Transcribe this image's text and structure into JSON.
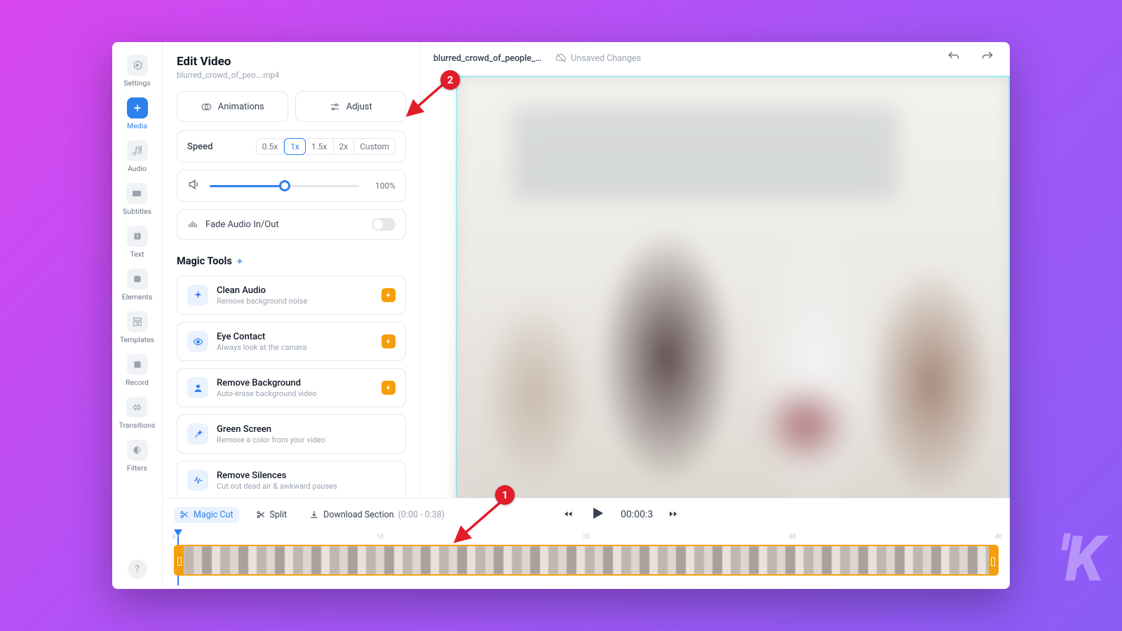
{
  "nav": {
    "items": [
      {
        "label": "Settings",
        "icon": "gear"
      },
      {
        "label": "Media",
        "icon": "plus",
        "active": true
      },
      {
        "label": "Audio",
        "icon": "music"
      },
      {
        "label": "Subtitles",
        "icon": "cc"
      },
      {
        "label": "Text",
        "icon": "text"
      },
      {
        "label": "Elements",
        "icon": "shapes"
      },
      {
        "label": "Templates",
        "icon": "templates"
      },
      {
        "label": "Record",
        "icon": "record"
      },
      {
        "label": "Transitions",
        "icon": "transitions"
      },
      {
        "label": "Filters",
        "icon": "filters"
      }
    ]
  },
  "panel": {
    "title": "Edit Video",
    "subtitle": "blurred_crowd_of_peo….mp4",
    "tabs": {
      "animations": "Animations",
      "adjust": "Adjust"
    },
    "speed": {
      "label": "Speed",
      "options": [
        "0.5x",
        "1x",
        "1.5x",
        "2x",
        "Custom"
      ],
      "selected": "1x"
    },
    "volume": {
      "percent": "100%",
      "value": 50
    },
    "fade": {
      "label": "Fade Audio In/Out",
      "on": false
    },
    "magic_heading": "Magic Tools",
    "tools": [
      {
        "title": "Clean Audio",
        "desc": "Remove background noise",
        "icon": "sparkle",
        "bolt": true
      },
      {
        "title": "Eye Contact",
        "desc": "Always look at the camera",
        "icon": "eye",
        "bolt": true
      },
      {
        "title": "Remove Background",
        "desc": "Auto-erase background video",
        "icon": "person",
        "bolt": true
      },
      {
        "title": "Green Screen",
        "desc": "Remove a color from your video",
        "icon": "wand",
        "bolt": false
      },
      {
        "title": "Remove Silences",
        "desc": "Cut out dead air & awkward pauses",
        "icon": "wave",
        "bolt": false
      }
    ]
  },
  "header": {
    "doc_name": "blurred_crowd_of_people_…",
    "unsaved": "Unsaved Changes"
  },
  "timeline": {
    "magic_cut": "Magic Cut",
    "split": "Split",
    "download": "Download Section",
    "download_range": "(0:00 - 0:38)",
    "timecode": "00:00:3",
    "ruler_marks": [
      "0",
      "10",
      "20",
      "30",
      "40"
    ]
  },
  "annotations": {
    "one": "1",
    "two": "2"
  }
}
